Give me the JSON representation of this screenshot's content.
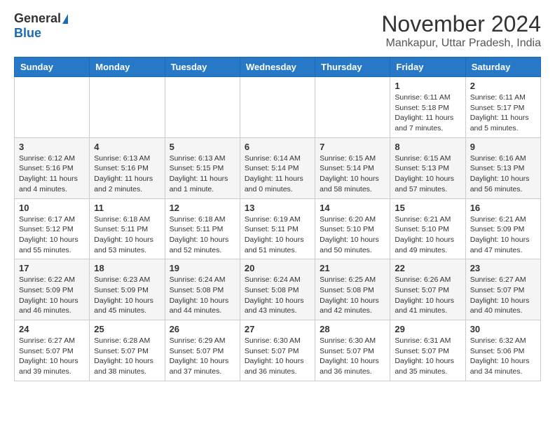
{
  "logo": {
    "general": "General",
    "blue": "Blue"
  },
  "header": {
    "month": "November 2024",
    "location": "Mankapur, Uttar Pradesh, India"
  },
  "weekdays": [
    "Sunday",
    "Monday",
    "Tuesday",
    "Wednesday",
    "Thursday",
    "Friday",
    "Saturday"
  ],
  "weeks": [
    [
      {
        "day": "",
        "info": ""
      },
      {
        "day": "",
        "info": ""
      },
      {
        "day": "",
        "info": ""
      },
      {
        "day": "",
        "info": ""
      },
      {
        "day": "",
        "info": ""
      },
      {
        "day": "1",
        "info": "Sunrise: 6:11 AM\nSunset: 5:18 PM\nDaylight: 11 hours and 7 minutes."
      },
      {
        "day": "2",
        "info": "Sunrise: 6:11 AM\nSunset: 5:17 PM\nDaylight: 11 hours and 5 minutes."
      }
    ],
    [
      {
        "day": "3",
        "info": "Sunrise: 6:12 AM\nSunset: 5:16 PM\nDaylight: 11 hours and 4 minutes."
      },
      {
        "day": "4",
        "info": "Sunrise: 6:13 AM\nSunset: 5:16 PM\nDaylight: 11 hours and 2 minutes."
      },
      {
        "day": "5",
        "info": "Sunrise: 6:13 AM\nSunset: 5:15 PM\nDaylight: 11 hours and 1 minute."
      },
      {
        "day": "6",
        "info": "Sunrise: 6:14 AM\nSunset: 5:14 PM\nDaylight: 11 hours and 0 minutes."
      },
      {
        "day": "7",
        "info": "Sunrise: 6:15 AM\nSunset: 5:14 PM\nDaylight: 10 hours and 58 minutes."
      },
      {
        "day": "8",
        "info": "Sunrise: 6:15 AM\nSunset: 5:13 PM\nDaylight: 10 hours and 57 minutes."
      },
      {
        "day": "9",
        "info": "Sunrise: 6:16 AM\nSunset: 5:13 PM\nDaylight: 10 hours and 56 minutes."
      }
    ],
    [
      {
        "day": "10",
        "info": "Sunrise: 6:17 AM\nSunset: 5:12 PM\nDaylight: 10 hours and 55 minutes."
      },
      {
        "day": "11",
        "info": "Sunrise: 6:18 AM\nSunset: 5:11 PM\nDaylight: 10 hours and 53 minutes."
      },
      {
        "day": "12",
        "info": "Sunrise: 6:18 AM\nSunset: 5:11 PM\nDaylight: 10 hours and 52 minutes."
      },
      {
        "day": "13",
        "info": "Sunrise: 6:19 AM\nSunset: 5:11 PM\nDaylight: 10 hours and 51 minutes."
      },
      {
        "day": "14",
        "info": "Sunrise: 6:20 AM\nSunset: 5:10 PM\nDaylight: 10 hours and 50 minutes."
      },
      {
        "day": "15",
        "info": "Sunrise: 6:21 AM\nSunset: 5:10 PM\nDaylight: 10 hours and 49 minutes."
      },
      {
        "day": "16",
        "info": "Sunrise: 6:21 AM\nSunset: 5:09 PM\nDaylight: 10 hours and 47 minutes."
      }
    ],
    [
      {
        "day": "17",
        "info": "Sunrise: 6:22 AM\nSunset: 5:09 PM\nDaylight: 10 hours and 46 minutes."
      },
      {
        "day": "18",
        "info": "Sunrise: 6:23 AM\nSunset: 5:09 PM\nDaylight: 10 hours and 45 minutes."
      },
      {
        "day": "19",
        "info": "Sunrise: 6:24 AM\nSunset: 5:08 PM\nDaylight: 10 hours and 44 minutes."
      },
      {
        "day": "20",
        "info": "Sunrise: 6:24 AM\nSunset: 5:08 PM\nDaylight: 10 hours and 43 minutes."
      },
      {
        "day": "21",
        "info": "Sunrise: 6:25 AM\nSunset: 5:08 PM\nDaylight: 10 hours and 42 minutes."
      },
      {
        "day": "22",
        "info": "Sunrise: 6:26 AM\nSunset: 5:07 PM\nDaylight: 10 hours and 41 minutes."
      },
      {
        "day": "23",
        "info": "Sunrise: 6:27 AM\nSunset: 5:07 PM\nDaylight: 10 hours and 40 minutes."
      }
    ],
    [
      {
        "day": "24",
        "info": "Sunrise: 6:27 AM\nSunset: 5:07 PM\nDaylight: 10 hours and 39 minutes."
      },
      {
        "day": "25",
        "info": "Sunrise: 6:28 AM\nSunset: 5:07 PM\nDaylight: 10 hours and 38 minutes."
      },
      {
        "day": "26",
        "info": "Sunrise: 6:29 AM\nSunset: 5:07 PM\nDaylight: 10 hours and 37 minutes."
      },
      {
        "day": "27",
        "info": "Sunrise: 6:30 AM\nSunset: 5:07 PM\nDaylight: 10 hours and 36 minutes."
      },
      {
        "day": "28",
        "info": "Sunrise: 6:30 AM\nSunset: 5:07 PM\nDaylight: 10 hours and 36 minutes."
      },
      {
        "day": "29",
        "info": "Sunrise: 6:31 AM\nSunset: 5:07 PM\nDaylight: 10 hours and 35 minutes."
      },
      {
        "day": "30",
        "info": "Sunrise: 6:32 AM\nSunset: 5:06 PM\nDaylight: 10 hours and 34 minutes."
      }
    ]
  ]
}
